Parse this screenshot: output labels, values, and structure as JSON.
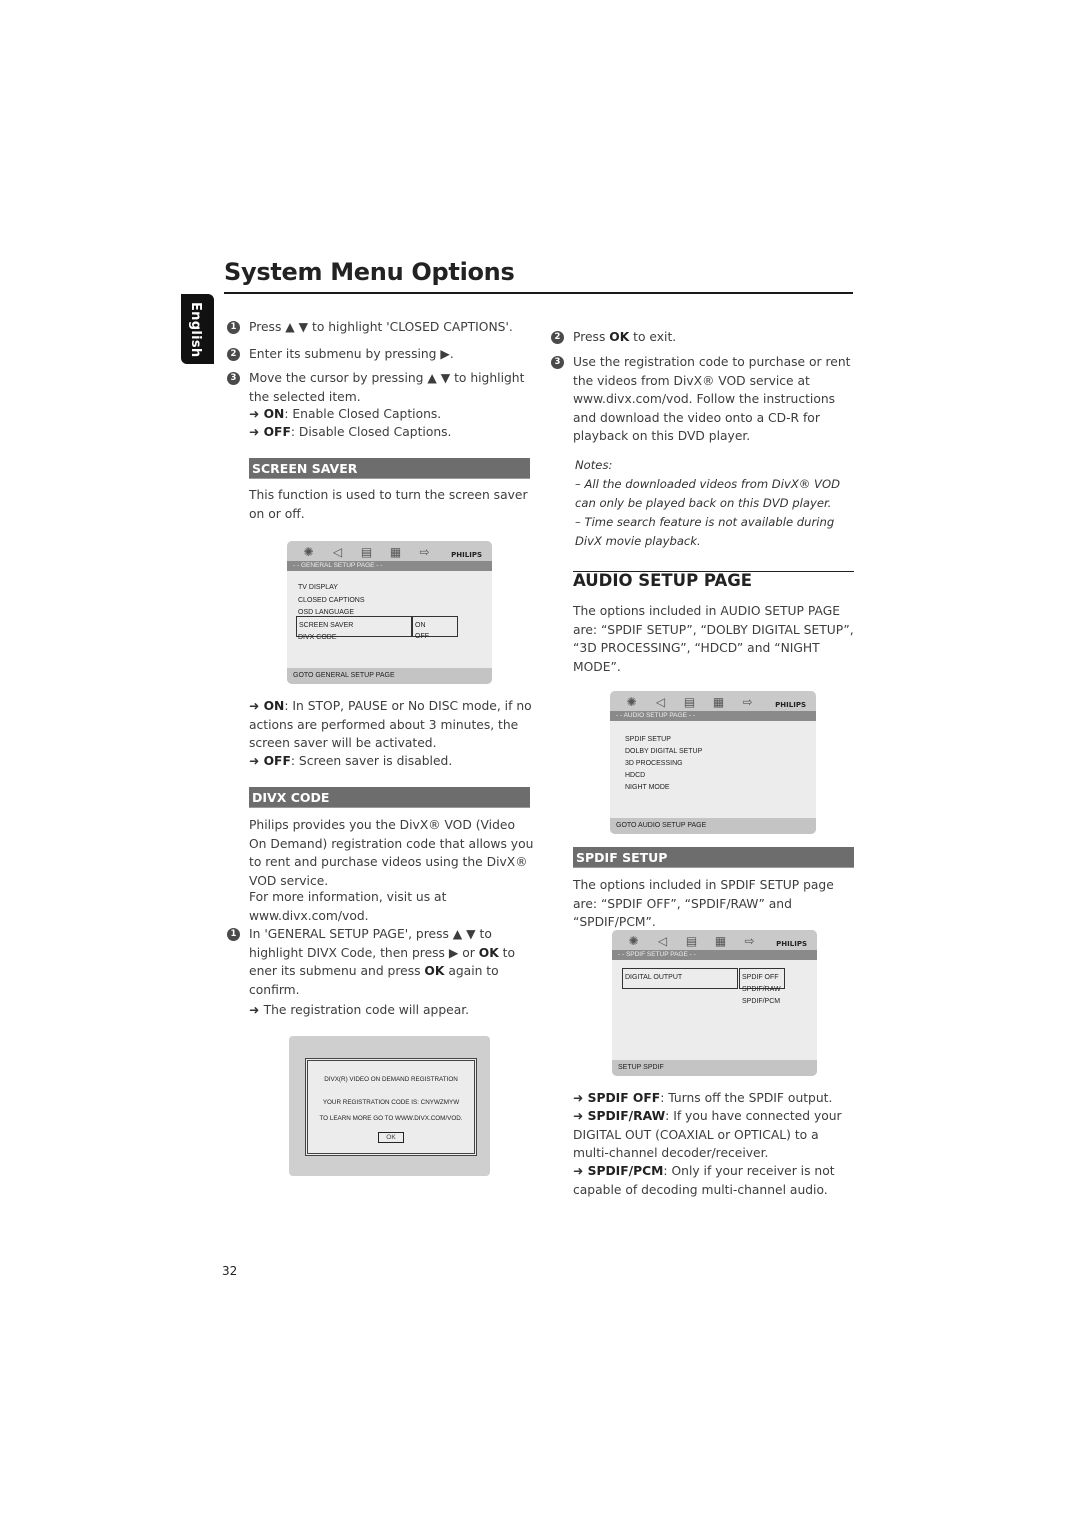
{
  "page": {
    "title": "System Menu Options",
    "language_tab": "English",
    "page_number": "32"
  },
  "left": {
    "steps_cc": [
      {
        "num": "1",
        "text_before": "Press ▲ ▼  to highlight 'CLOSED CAPTIONS'."
      },
      {
        "num": "2",
        "text_before": "Enter its submenu by pressing ▶."
      },
      {
        "num": "3",
        "text_before": "Move the cursor by pressing ▲ ▼  to highlight the selected item."
      }
    ],
    "cc_options": [
      {
        "key": "ON",
        "desc": ": Enable Closed Captions."
      },
      {
        "key": "OFF",
        "desc": ": Disable Closed Captions."
      }
    ],
    "screen_saver": {
      "heading": "SCREEN SAVER",
      "intro": "This function is used to turn the screen saver on or off.",
      "options": [
        {
          "key": "ON",
          "desc": ": In STOP, PAUSE or No DISC mode, if no actions are performed about 3 minutes, the screen saver will be activated."
        },
        {
          "key": "OFF",
          "desc": ": Screen saver is disabled."
        }
      ]
    },
    "general_osd": {
      "brand": "PHILIPS",
      "icons": [
        "gear-icon",
        "speaker-icon",
        "video-icon",
        "grid-icon",
        "exit-icon"
      ],
      "subtitle": "- -  GENERAL  SETUP  PAGE  - -",
      "items": [
        "TV DISPLAY",
        "CLOSED CAPTIONS",
        "OSD LANGUAGE",
        "SCREEN SAVER",
        "DIVX CODE"
      ],
      "selected_item": "SCREEN SAVER",
      "values": [
        "ON",
        "OFF"
      ],
      "selected_value": "ON",
      "footer": "GOTO GENERAL SETUP PAGE"
    },
    "divx": {
      "heading": "DIVX CODE",
      "intro_1": "Philips provides you the DivX® VOD (Video On Demand) registration code that allows you to rent and purchase videos using the DivX® VOD service.",
      "intro_2": "For more information, visit us at www.divx.com/vod.",
      "step1_a": "In 'GENERAL SETUP PAGE', press ▲ ▼ to highlight DIVX Code, then press ▶ or ",
      "step1_ok1": "OK",
      "step1_b": " to ener its submenu and press ",
      "step1_ok2": "OK",
      "step1_c": " again to confirm.",
      "result": "The registration code will appear."
    },
    "divx_dialog": {
      "line1": "DIVX(R) VIDEO ON DEMAND REGISTRATION",
      "line2": "YOUR REGISTRATION CODE IS: CNYWZMYW",
      "line3": "TO LEARN MORE GO TO WWW.DIVX.COM/VOD.",
      "ok": "OK"
    }
  },
  "right": {
    "step2_a": "Press ",
    "step2_ok": "OK",
    "step2_b": " to exit.",
    "step3": "Use the registration code to purchase or rent the videos from DivX® VOD service at www.divx.com/vod. Follow the instructions and download the video onto a CD-R for playback on this DVD player.",
    "notes_title": "Notes:",
    "notes": [
      "–   All the downloaded videos from DivX® VOD can only be played back on this DVD player.",
      "–   Time search feature is not available during DivX movie playback."
    ],
    "audio": {
      "heading": "AUDIO SETUP PAGE",
      "intro": "The options included in AUDIO SETUP PAGE are: “SPDIF SETUP”, “DOLBY DIGITAL SETUP”, “3D PROCESSING”, “HDCD” and “NIGHT MODE”."
    },
    "audio_osd": {
      "brand": "PHILIPS",
      "subtitle": "- -  AUDIO  SETUP  PAGE  - -",
      "items": [
        "SPDIF SETUP",
        "DOLBY DIGITAL SETUP",
        "3D PROCESSING",
        "HDCD",
        "NIGHT MODE"
      ],
      "footer": "GOTO AUDIO SETUP PAGE"
    },
    "spdif": {
      "heading": "SPDIF SETUP",
      "intro": "The options included in SPDIF SETUP page are: “SPDIF OFF”, “SPDIF/RAW” and “SPDIF/PCM”.",
      "options": [
        {
          "key": "SPDIF OFF",
          "desc": ": Turns off the SPDIF output."
        },
        {
          "key": "SPDIF/RAW",
          "desc": ": If you have connected your DIGITAL OUT (COAXIAL or OPTICAL) to a multi-channel decoder/receiver."
        },
        {
          "key": "SPDIF/PCM",
          "desc": ": Only if your receiver is not capable of decoding multi-channel audio."
        }
      ]
    },
    "spdif_osd": {
      "brand": "PHILIPS",
      "subtitle": "- -  SPDIF SETUP PAGE  - -",
      "item": "DIGITAL OUTPUT",
      "values": [
        "SPDIF OFF",
        "SPDIF/RAW",
        "SPDIF/PCM"
      ],
      "selected_value": "SPDIF OFF",
      "footer": "SETUP SPDIF"
    }
  }
}
